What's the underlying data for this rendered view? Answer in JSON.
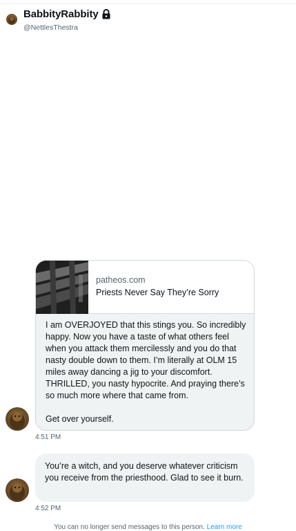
{
  "header": {
    "display_name": "BabbityRabbity",
    "handle": "@NettlesThestra",
    "protected_icon": "lock-icon"
  },
  "messages": [
    {
      "link_card": {
        "domain": "patheos.com",
        "title": "Priests Never Say They’re Sorry"
      },
      "text": "I am OVERJOYED that this stings you. So incredibly happy. Now you have a taste of what others feel when you attack them mercilessly and you do that nasty double down to them. I’m literally at OLM 15 miles away dancing a jig to your discomfort. THRILLED, you nasty hypocrite. And praying there’s so much more where that came from.\n\nGet over yourself.",
      "time": "4:51 PM"
    },
    {
      "text": "You’re a witch, and you deserve whatever criticism you receive from the priesthood. Glad to see it burn.",
      "time": "4:52 PM"
    }
  ],
  "footer": {
    "notice": "You can no longer send messages to this person.",
    "link_label": "Learn more"
  },
  "colors": {
    "bubble_bg": "#eff3f4",
    "secondary_text": "#536471",
    "link": "#1d9bf0"
  }
}
